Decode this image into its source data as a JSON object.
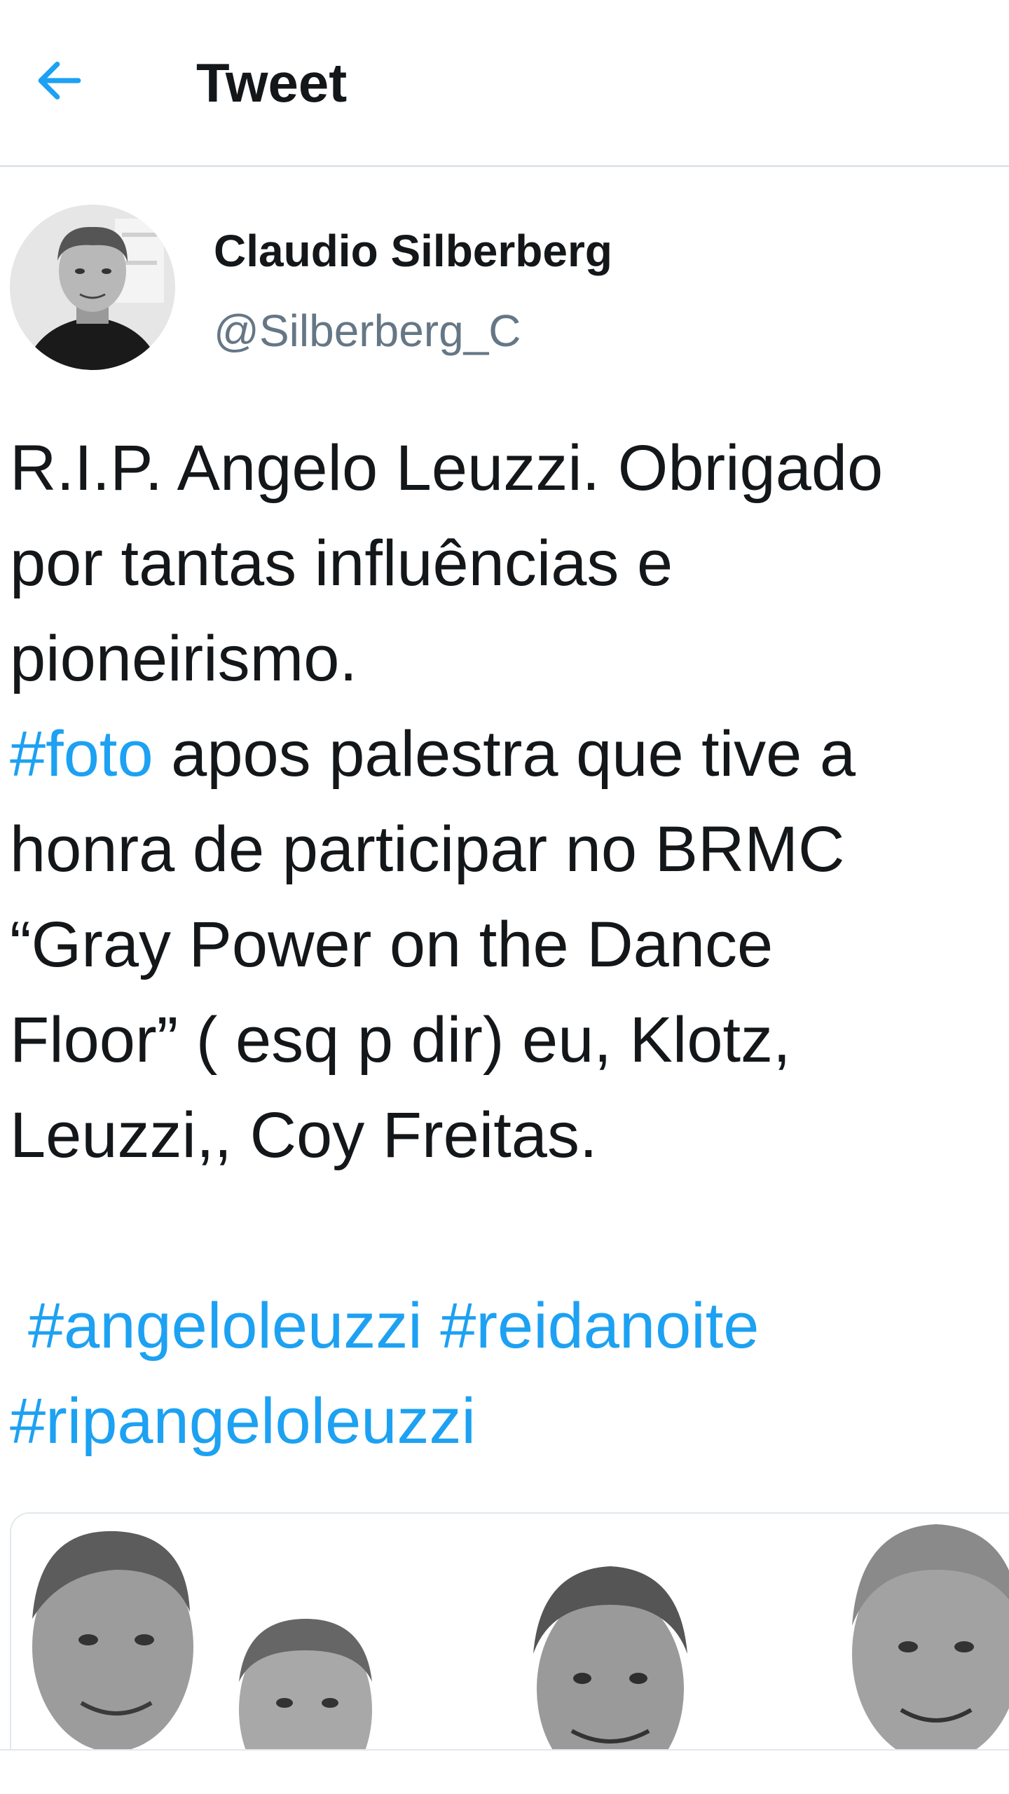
{
  "header": {
    "title": "Tweet",
    "back_icon": "arrow-left-icon",
    "accent": "#1da1f2"
  },
  "author": {
    "name": "Claudio Silberberg",
    "handle": "@Silberberg_C"
  },
  "tweet": {
    "line1": "R.I.P. Angelo Leuzzi. Obrigado",
    "line2": "por tantas influências e",
    "line3": "pioneirismo.",
    "hashtag_foto": "#foto",
    "line4_rest": " apos palestra que tive a",
    "line5": "honra de participar no BRMC",
    "line6": "“Gray Power on the Dance",
    "line7": "Floor” ( esq p dir) eu, Klotz,",
    "line8": "Leuzzi,, Coy Freitas.",
    "hashtag_angeloleuzzi": "#angeloleuzzi",
    "hashtag_reidanoite": "#reidanoite",
    "hashtag_ripangeloleuzzi": "#ripangeloleuzzi"
  },
  "colors": {
    "text": "#14171a",
    "secondary": "#657786",
    "link": "#1da1f2",
    "divider": "#d4dce3"
  }
}
